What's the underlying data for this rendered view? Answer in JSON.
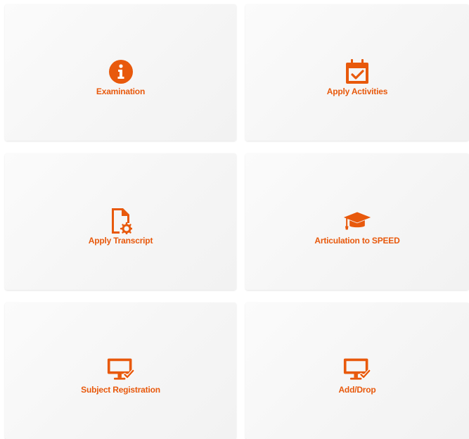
{
  "colors": {
    "accent": "#e8590c",
    "tile_bg": "#f7f7f7"
  },
  "tiles": [
    {
      "label": "Examination",
      "icon": "info-circle-icon"
    },
    {
      "label": "Apply Activities",
      "icon": "calendar-check-icon"
    },
    {
      "label": "Apply Transcript",
      "icon": "file-cog-icon"
    },
    {
      "label": "Articulation to SPEED",
      "icon": "graduation-cap-icon"
    },
    {
      "label": "Subject Registration",
      "icon": "monitor-check-icon"
    },
    {
      "label": "Add/Drop",
      "icon": "monitor-check-icon"
    }
  ]
}
